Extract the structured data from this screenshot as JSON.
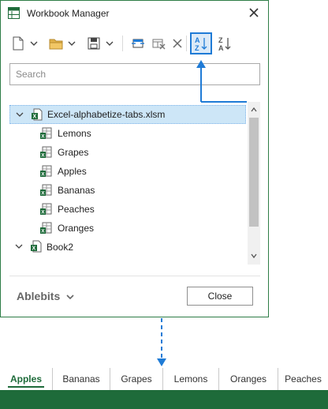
{
  "dialog": {
    "title": "Workbook Manager",
    "search_placeholder": "Search",
    "brand": "Ablebits",
    "close_button": "Close"
  },
  "toolbar": {
    "buttons": [
      {
        "name": "new-sheet",
        "icon": "new-document-icon"
      },
      {
        "name": "new-dropdown",
        "icon": "chevron-down-icon"
      },
      {
        "name": "open-folder",
        "icon": "folder-icon"
      },
      {
        "name": "open-dropdown",
        "icon": "chevron-down-icon"
      },
      {
        "name": "save",
        "icon": "save-icon"
      },
      {
        "name": "save-dropdown",
        "icon": "chevron-down-icon"
      },
      {
        "name": "move-sheet",
        "icon": "move-sheet-icon"
      },
      {
        "name": "hide-sheet",
        "icon": "hide-sheet-icon"
      },
      {
        "name": "delete",
        "icon": "delete-x-icon"
      },
      {
        "name": "sort-az",
        "icon": "sort-a-z-icon",
        "active": true
      },
      {
        "name": "sort-za",
        "icon": "sort-z-a-icon"
      }
    ]
  },
  "tree": {
    "workbook1": {
      "name": "Excel-alphabetize-tabs.xlsm",
      "sheets": [
        "Lemons",
        "Grapes",
        "Apples",
        "Bananas",
        "Peaches",
        "Oranges"
      ]
    },
    "workbook2": {
      "name": "Book2"
    }
  },
  "sheet_tabs": [
    "Apples",
    "Bananas",
    "Grapes",
    "Lemons",
    "Oranges",
    "Peaches"
  ],
  "colors": {
    "excel_green": "#1e6b3a",
    "accent_blue": "#1f7bd6",
    "selected_row": "#cde6f7"
  }
}
